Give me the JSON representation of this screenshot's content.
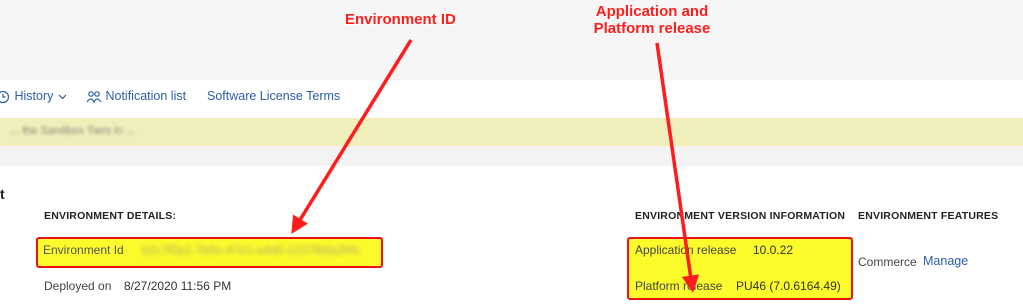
{
  "annotations": {
    "environment_id_label": "Environment ID",
    "release_label_line1": "Application and",
    "release_label_line2": "Platform release"
  },
  "toolbar": {
    "history_label": "History",
    "notification_label": "Notification list",
    "license_label": "Software License Terms"
  },
  "banner": {
    "text": "... the Sandbox Tiers in ..."
  },
  "page": {
    "title_fragment": "t"
  },
  "environment_details": {
    "heading": "ENVIRONMENT DETAILS:",
    "environment_id_label": "Environment Id",
    "environment_id_value": "b2c7f0a1-7b5e-47e1-a4d0-1237fb6a2f4c",
    "deployed_label": "Deployed on",
    "deployed_value": "8/27/2020 11:56 PM"
  },
  "version_info": {
    "heading": "ENVIRONMENT VERSION INFORMATION",
    "application_release_label": "Application release",
    "application_release_value": "10.0.22",
    "platform_release_label": "Platform release",
    "platform_release_value": "PU46 (7.0.6164.49)"
  },
  "features": {
    "heading": "ENVIRONMENT FEATURES",
    "commerce_label": "Commerce",
    "manage_label": "Manage"
  },
  "colors": {
    "link": "#2b5ea7",
    "annotation_red": "#ff1c1c",
    "highlight_yellow": "#fbfb2c",
    "banner_bg": "#f0eebb"
  }
}
